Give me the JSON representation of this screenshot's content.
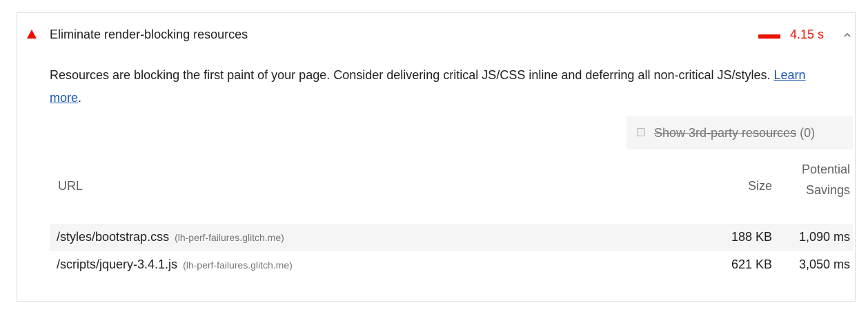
{
  "audit": {
    "title": "Eliminate render-blocking resources",
    "savings_display": "4.15 s",
    "status_color": "#eb0f00",
    "status_icon": "fail-triangle-icon",
    "expand_icon": "chevron-up-icon",
    "description_text": "Resources are blocking the first paint of your page. Consider delivering critical JS/CSS inline and deferring all non-critical JS/styles. ",
    "learn_more_label": "Learn more",
    "description_end": "."
  },
  "third_party_filter": {
    "label": "Show 3rd-party resources",
    "count": "(0)",
    "checked": false
  },
  "table": {
    "headers": {
      "url": "URL",
      "size": "Size",
      "savings": "Potential Savings"
    },
    "rows": [
      {
        "url": "/styles/bootstrap.css",
        "host": "(lh-perf-failures.glitch.me)",
        "size": "188 KB",
        "savings": "1,090 ms"
      },
      {
        "url": "/scripts/jquery-3.4.1.js",
        "host": "(lh-perf-failures.glitch.me)",
        "size": "621 KB",
        "savings": "3,050 ms"
      }
    ]
  }
}
